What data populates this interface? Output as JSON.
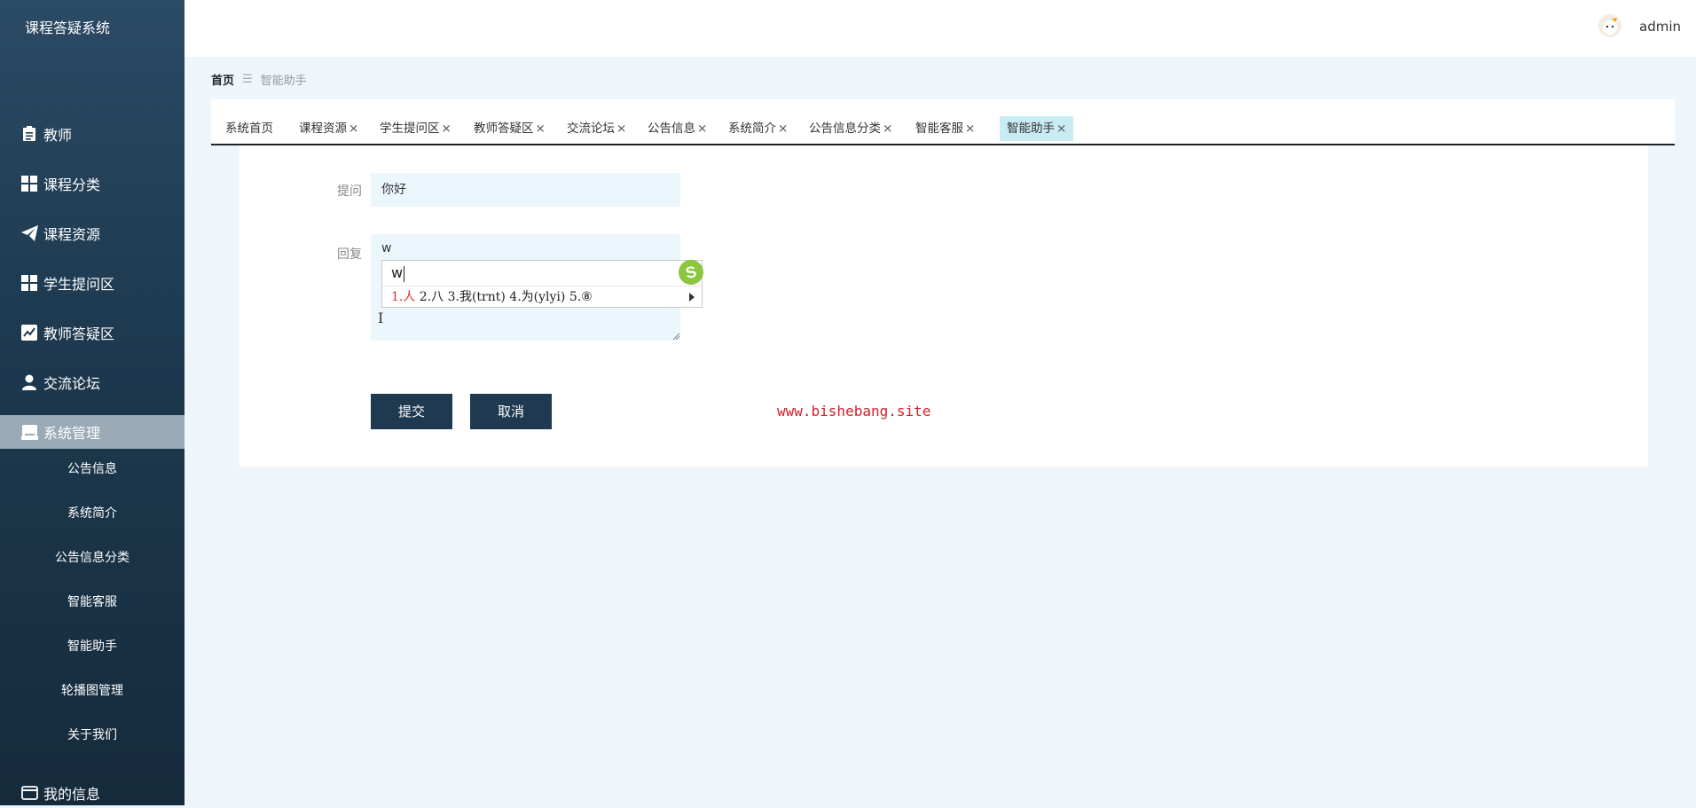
{
  "app": {
    "title": "课程答疑系统"
  },
  "header": {
    "username": "admin"
  },
  "sidebar": {
    "items": [
      {
        "label": "教师",
        "icon": "clipboard-icon"
      },
      {
        "label": "课程分类",
        "icon": "grid-icon"
      },
      {
        "label": "课程资源",
        "icon": "paper-plane-icon"
      },
      {
        "label": "学生提问区",
        "icon": "grid-icon"
      },
      {
        "label": "教师答疑区",
        "icon": "chart-line-icon"
      },
      {
        "label": "交流论坛",
        "icon": "user-icon"
      },
      {
        "label": "系统管理",
        "icon": "inbox-icon",
        "active": true
      },
      {
        "label": "我的信息",
        "icon": "card-icon"
      }
    ],
    "submenu": [
      "公告信息",
      "系统简介",
      "公告信息分类",
      "智能客服",
      "智能助手",
      "轮播图管理",
      "关于我们"
    ]
  },
  "breadcrumb": {
    "home": "首页",
    "separator": "☰",
    "current": "智能助手"
  },
  "tabs": [
    {
      "label": "系统首页",
      "closable": false
    },
    {
      "label": "课程资源",
      "closable": true
    },
    {
      "label": "学生提问区",
      "closable": true
    },
    {
      "label": "教师答疑区",
      "closable": true
    },
    {
      "label": "交流论坛",
      "closable": true
    },
    {
      "label": "公告信息",
      "closable": true
    },
    {
      "label": "系统简介",
      "closable": true
    },
    {
      "label": "公告信息分类",
      "closable": true
    },
    {
      "label": "智能客服",
      "closable": true
    },
    {
      "label": "智能助手",
      "closable": true,
      "active": true
    }
  ],
  "tab_close_glyph": "×",
  "form": {
    "question_label": "提问",
    "question_value": "你好",
    "reply_label": "回复",
    "reply_value": "w"
  },
  "ime": {
    "composition": "w",
    "candidates_first": "1.人",
    "candidates_rest": " 2.八 3.我(trnt) 4.为(ylyi) 5.⑧",
    "logo": "S"
  },
  "buttons": {
    "submit": "提交",
    "cancel": "取消"
  },
  "watermark": "www.bishebang.site",
  "colors": {
    "sidebar": "#1e3a50",
    "active_menu": "#9aaab7",
    "active_tab": "#c9ecf4",
    "button": "#1f3a50",
    "watermark": "#d0202a"
  }
}
